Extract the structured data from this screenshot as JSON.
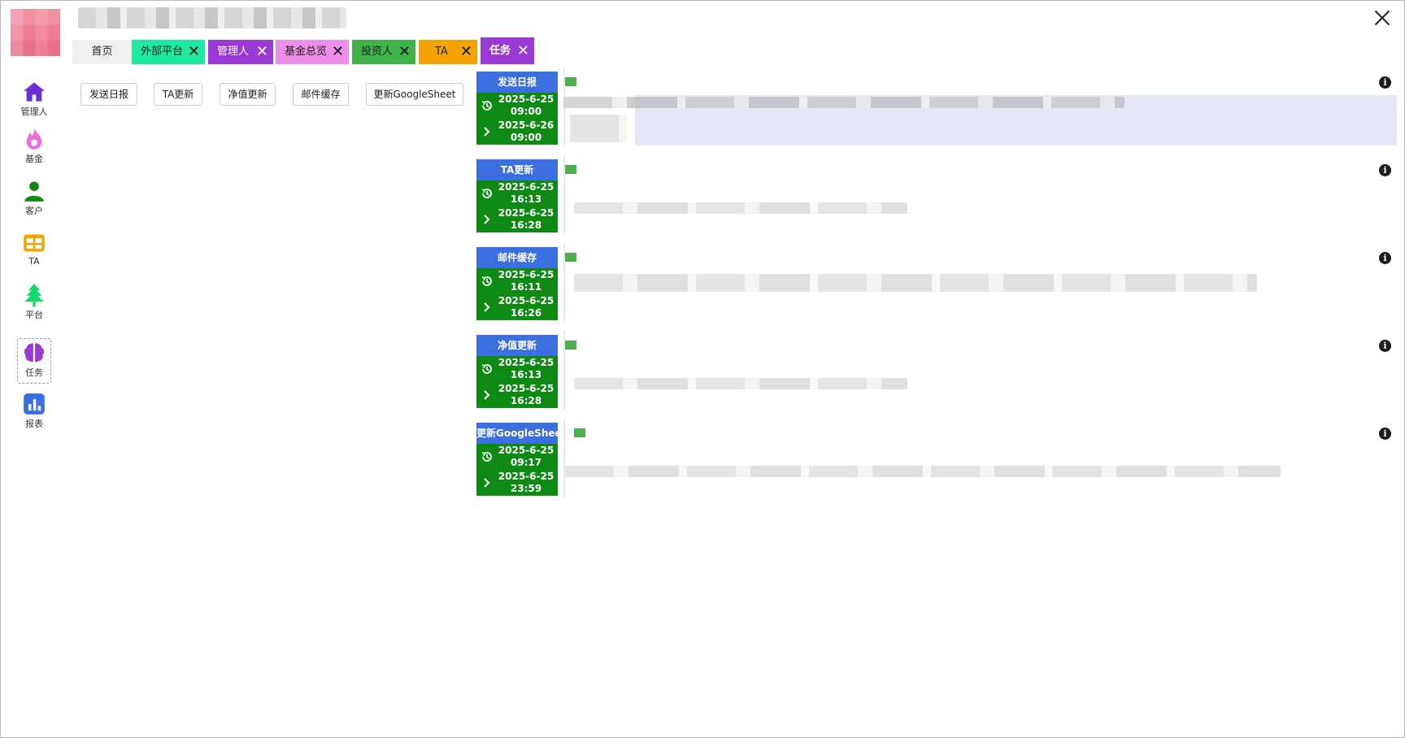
{
  "window": {
    "close_label": "×"
  },
  "sidebar": {
    "items": [
      {
        "label": "管理人",
        "icon": "home-icon",
        "color": "#6b2fd9"
      },
      {
        "label": "基金",
        "icon": "fire-icon",
        "color": "#e86de0"
      },
      {
        "label": "客户",
        "icon": "person-icon",
        "color": "#0e8a14"
      },
      {
        "label": "TA",
        "icon": "table-icon",
        "color": "#f5a300"
      },
      {
        "label": "平台",
        "icon": "tree-icon",
        "color": "#15d96a"
      },
      {
        "label": "任务",
        "icon": "brain-icon",
        "color": "#9b39d6"
      },
      {
        "label": "报表",
        "icon": "chart-icon",
        "color": "#3b6fe0"
      }
    ]
  },
  "tabs": [
    {
      "label": "首页",
      "color": "#f0f0f0",
      "closable": false
    },
    {
      "label": "外部平台",
      "color": "#1de9a0",
      "closable": true
    },
    {
      "label": "管理人",
      "color": "#9b39d6",
      "closable": true
    },
    {
      "label": "基金总览",
      "color": "#ef8ee8",
      "closable": true
    },
    {
      "label": "投资人",
      "color": "#3fb34a",
      "closable": true
    },
    {
      "label": "TA",
      "color": "#f5a300",
      "closable": true
    },
    {
      "label": "任务",
      "color": "#9b39d6",
      "closable": true,
      "active": true
    }
  ],
  "tab_close_glyph": "✕",
  "actions": [
    "发送日报",
    "TA更新",
    "净值更新",
    "邮件缓存",
    "更新GoogleSheet"
  ],
  "tasks": [
    {
      "name": "发送日报",
      "last_date": "2025-6-25",
      "last_time": "09:00",
      "next_date": "2025-6-26",
      "next_time": "09:00"
    },
    {
      "name": "TA更新",
      "last_date": "2025-6-25",
      "last_time": "16:13",
      "next_date": "2025-6-25",
      "next_time": "16:28"
    },
    {
      "name": "邮件缓存",
      "last_date": "2025-6-25",
      "last_time": "16:11",
      "next_date": "2025-6-25",
      "next_time": "16:26"
    },
    {
      "name": "净值更新",
      "last_date": "2025-6-25",
      "last_time": "16:13",
      "next_date": "2025-6-25",
      "next_time": "16:28"
    },
    {
      "name": "更新GoogleSheet",
      "last_date": "2025-6-25",
      "last_time": "09:17",
      "next_date": "2025-6-25",
      "next_time": "23:59"
    }
  ],
  "info_glyph": "i",
  "colors": {
    "task_head": "#3b6fe0",
    "task_body": "#0e8a14",
    "flag": "#4caf50"
  }
}
